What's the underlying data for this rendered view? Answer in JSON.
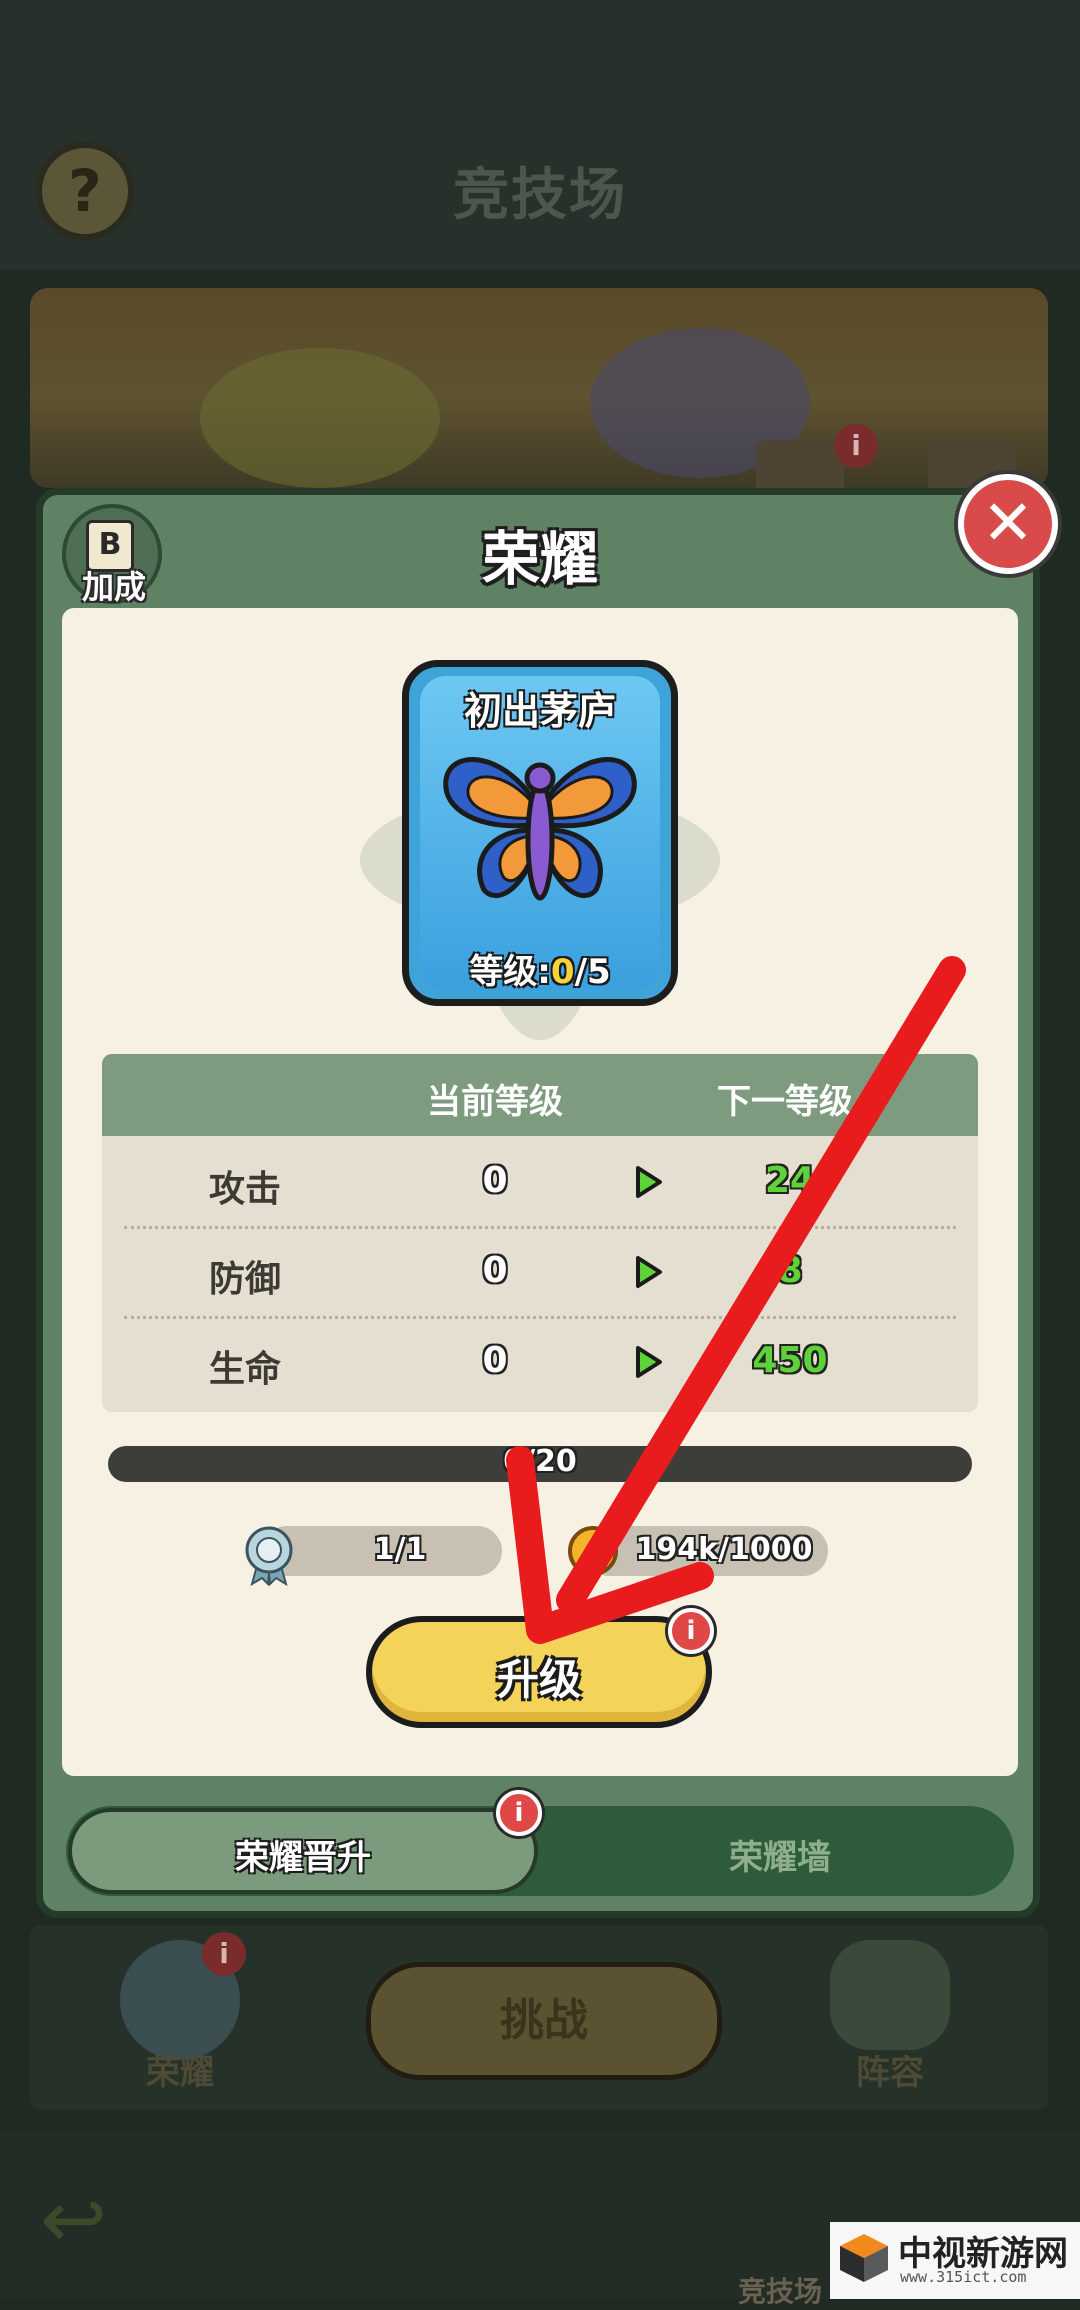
{
  "background": {
    "arena_title": "竞技场",
    "help_icon": "question-mark-icon",
    "help_glyph": "?",
    "bottom": {
      "challenge_label": "挑战",
      "honor_label": "荣耀",
      "lineup_label": "阵容"
    },
    "nav": {
      "arena_label": "竞技场"
    },
    "back_glyph": "↩",
    "badge_glyph": "i"
  },
  "modal": {
    "title": "荣耀",
    "bonus_label": "加成",
    "bonus_icon_glyph": "B",
    "close_glyph": "✕",
    "card": {
      "name": "初出茅庐",
      "level_prefix": "等级:",
      "level_current": "0",
      "level_max": "/5",
      "icon": "butterfly-icon"
    },
    "stats": {
      "col_current": "当前等级",
      "col_next": "下一等级",
      "rows": [
        {
          "name": "攻击",
          "current": "0",
          "next": "24"
        },
        {
          "name": "防御",
          "current": "0",
          "next": "8"
        },
        {
          "name": "生命",
          "current": "0",
          "next": "450"
        }
      ]
    },
    "progress": {
      "text": "0/20",
      "fraction": 0
    },
    "requirements": {
      "medal_text": "1/1",
      "coin_text": "194k/1000"
    },
    "upgrade_label": "升级",
    "notification_glyph": "i",
    "tabs": [
      {
        "label": "荣耀晋升",
        "active": true
      },
      {
        "label": "荣耀墙",
        "active": false
      }
    ]
  },
  "watermark": {
    "text": "中视新游网",
    "url": "www.315ict.com"
  },
  "colors": {
    "modal_green": "#5f8164",
    "panel_cream": "#f6f1e3",
    "card_blue": "#3da3d8",
    "stat_next_green": "#5fd23a",
    "button_yellow": "#f3d35a",
    "alert_red": "#e04747",
    "annotation_arrow": "#e81c1c"
  }
}
